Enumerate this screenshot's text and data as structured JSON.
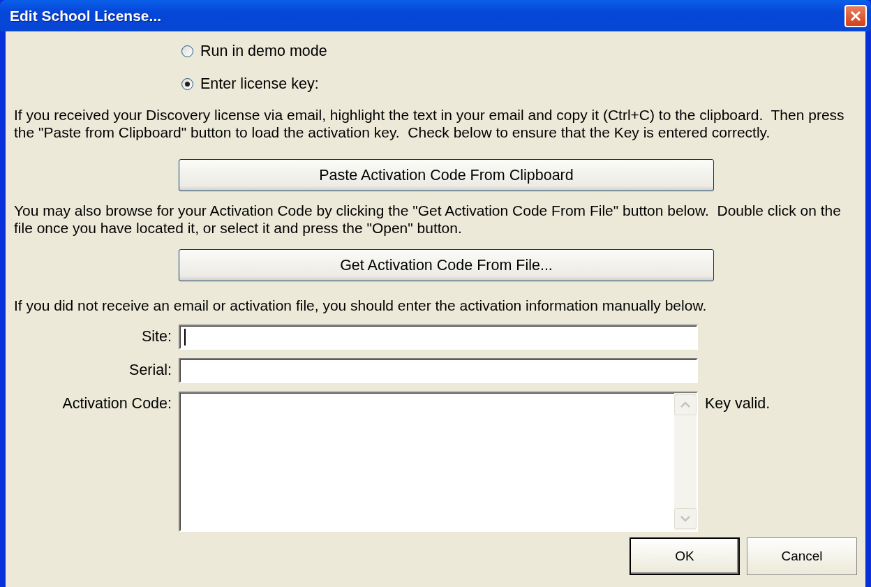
{
  "window": {
    "title": "Edit School License..."
  },
  "radios": [
    {
      "label": "Run in demo mode",
      "selected": false
    },
    {
      "label": "Enter license key:",
      "selected": true
    }
  ],
  "intro_text": "If you received your Discovery license via email, highlight the text in your email and copy it (Ctrl+C) to the clipboard.  Then press the \"Paste from Clipboard\" button to load the activation key.  Check below to ensure that the Key is entered correctly.",
  "paste_button": "Paste Activation Code From Clipboard",
  "browse_text": "You may also browse for your Activation Code by clicking the \"Get Activation Code From File\" button below.  Double click on the file once you have located it, or select it and press the \"Open\" button.",
  "file_button": "Get Activation Code From File...",
  "manual_text": "If you did not receive an email or activation file, you should enter the activation information manually below.",
  "fields": [
    {
      "label": "Site:",
      "kind": "line",
      "focused": true
    },
    {
      "label": "Serial:",
      "kind": "line",
      "focused": false
    },
    {
      "label": "Activation Code:",
      "kind": "multiline",
      "focused": false
    }
  ],
  "key_status": "Key valid.",
  "buttons": [
    {
      "label": "OK",
      "default": true
    },
    {
      "label": "Cancel",
      "default": false
    }
  ]
}
